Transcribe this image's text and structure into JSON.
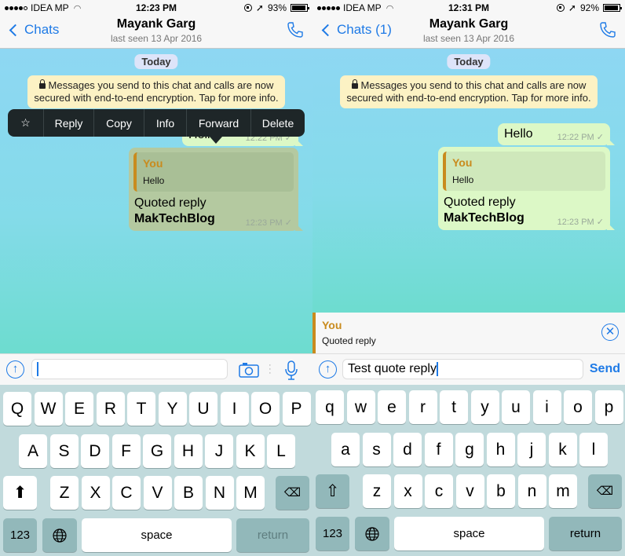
{
  "left": {
    "status": {
      "carrier": "IDEA MP",
      "signal_bars": 4,
      "time": "12:23 PM",
      "battery": "93%",
      "battery_level": 0.93
    },
    "nav": {
      "back": "Chats",
      "title": "Mayank Garg",
      "subtitle": "last seen 13 Apr 2016"
    },
    "date_chip": "Today",
    "encryption_notice": "Messages you send to this chat and calls are now secured with end-to-end encryption. Tap for more info.",
    "messages": [
      {
        "text": "Hello",
        "time": "12:22 PM"
      },
      {
        "quote_author": "You",
        "quote_text": "Hello",
        "line1": "Quoted reply",
        "line2": "MakTechBlog",
        "time": "12:23 PM"
      }
    ],
    "context_menu": [
      "☆",
      "Reply",
      "Copy",
      "Info",
      "Forward",
      "Delete"
    ],
    "input": {
      "value": ""
    },
    "keyboard": {
      "row1": [
        "Q",
        "W",
        "E",
        "R",
        "T",
        "Y",
        "U",
        "I",
        "O",
        "P"
      ],
      "row2": [
        "A",
        "S",
        "D",
        "F",
        "G",
        "H",
        "J",
        "K",
        "L"
      ],
      "row3": [
        "Z",
        "X",
        "C",
        "V",
        "B",
        "N",
        "M"
      ],
      "shift": "⬆",
      "backspace": "⌫",
      "numbers": "123",
      "globe": "🌐",
      "space": "space",
      "return": "return"
    }
  },
  "right": {
    "status": {
      "carrier": "IDEA MP",
      "signal_bars": 5,
      "time": "12:31 PM",
      "battery": "92%",
      "battery_level": 0.92
    },
    "nav": {
      "back": "Chats (1)",
      "title": "Mayank Garg",
      "subtitle": "last seen 13 Apr 2016"
    },
    "date_chip": "Today",
    "encryption_notice": "Messages you send to this chat and calls are now secured with end-to-end encryption. Tap for more info.",
    "messages": [
      {
        "text": "Hello",
        "time": "12:22 PM"
      },
      {
        "quote_author": "You",
        "quote_text": "Hello",
        "line1": "Quoted reply",
        "line2": "MakTechBlog",
        "time": "12:23 PM"
      }
    ],
    "reply_preview": {
      "author": "You",
      "text": "Quoted reply",
      "close": "✕"
    },
    "input": {
      "value": "Test quote reply",
      "send": "Send"
    },
    "keyboard": {
      "row1": [
        "q",
        "w",
        "e",
        "r",
        "t",
        "y",
        "u",
        "i",
        "o",
        "p"
      ],
      "row2": [
        "a",
        "s",
        "d",
        "f",
        "g",
        "h",
        "j",
        "k",
        "l"
      ],
      "row3": [
        "z",
        "x",
        "c",
        "v",
        "b",
        "n",
        "m"
      ],
      "shift": "⇧",
      "backspace": "⌫",
      "numbers": "123",
      "globe": "🌐",
      "space": "space",
      "return": "return"
    }
  },
  "colors": {
    "accent": "#1e7ae6",
    "bubble": "#dcf8c6",
    "quote_bar": "#c98b1e",
    "notice": "#fcf2c4"
  }
}
